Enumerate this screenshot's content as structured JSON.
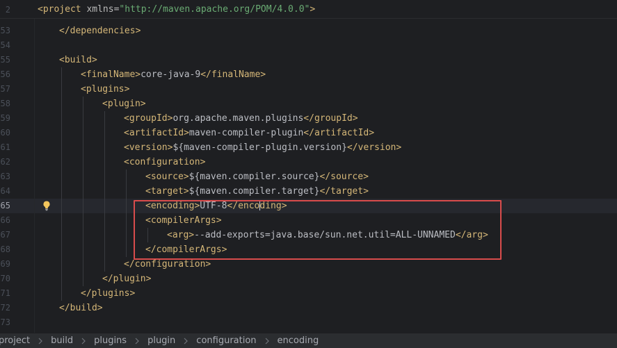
{
  "sticky": {
    "line_number": "2",
    "tag_open": "<project",
    "attr_name": "xmlns",
    "equals": "=",
    "attr_value": "\"http://maven.apache.org/POM/4.0.0\"",
    "tag_close": ">"
  },
  "editor": {
    "lines": [
      {
        "n": "53",
        "indent": 1,
        "parts": [
          {
            "c": "tg",
            "t": "</dependencies>"
          }
        ]
      },
      {
        "n": "54",
        "indent": 0,
        "parts": []
      },
      {
        "n": "55",
        "indent": 1,
        "parts": [
          {
            "c": "tg",
            "t": "<build>"
          }
        ]
      },
      {
        "n": "56",
        "indent": 2,
        "parts": [
          {
            "c": "tg",
            "t": "<finalName>"
          },
          {
            "c": "tx",
            "t": "core-java-9"
          },
          {
            "c": "tg",
            "t": "</finalName>"
          }
        ]
      },
      {
        "n": "57",
        "indent": 2,
        "parts": [
          {
            "c": "tg",
            "t": "<plugins>"
          }
        ]
      },
      {
        "n": "58",
        "indent": 3,
        "parts": [
          {
            "c": "tg",
            "t": "<plugin>"
          }
        ]
      },
      {
        "n": "59",
        "indent": 4,
        "parts": [
          {
            "c": "tg",
            "t": "<groupId>"
          },
          {
            "c": "tx",
            "t": "org.apache.maven.plugins"
          },
          {
            "c": "tg",
            "t": "</groupId>"
          }
        ]
      },
      {
        "n": "60",
        "indent": 4,
        "parts": [
          {
            "c": "tg",
            "t": "<artifactId>"
          },
          {
            "c": "tx",
            "t": "maven-compiler-plugin"
          },
          {
            "c": "tg",
            "t": "</artifactId>"
          }
        ]
      },
      {
        "n": "61",
        "indent": 4,
        "parts": [
          {
            "c": "tg",
            "t": "<version>"
          },
          {
            "c": "tx",
            "t": "${maven-compiler-plugin.version}"
          },
          {
            "c": "tg",
            "t": "</version>"
          }
        ]
      },
      {
        "n": "62",
        "indent": 4,
        "parts": [
          {
            "c": "tg",
            "t": "<configuration>"
          }
        ]
      },
      {
        "n": "63",
        "indent": 5,
        "parts": [
          {
            "c": "tg",
            "t": "<source>"
          },
          {
            "c": "tx",
            "t": "${maven.compiler.source}"
          },
          {
            "c": "tg",
            "t": "</source>"
          }
        ]
      },
      {
        "n": "64",
        "indent": 5,
        "parts": [
          {
            "c": "tg",
            "t": "<target>"
          },
          {
            "c": "tx",
            "t": "${maven.compiler.target}"
          },
          {
            "c": "tg",
            "t": "</target>"
          }
        ]
      },
      {
        "n": "65",
        "indent": 5,
        "current": true,
        "bulb": true,
        "parts": [
          {
            "c": "tg",
            "t": "<encoding>"
          },
          {
            "c": "tx",
            "t": "UTF-8"
          },
          {
            "c": "tg",
            "t": "</enco"
          },
          {
            "c": "caret",
            "t": ""
          },
          {
            "c": "tg",
            "t": "ding>"
          }
        ]
      },
      {
        "n": "66",
        "indent": 5,
        "parts": [
          {
            "c": "tg",
            "t": "<compilerArgs>"
          }
        ]
      },
      {
        "n": "67",
        "indent": 6,
        "parts": [
          {
            "c": "tg",
            "t": "<arg>"
          },
          {
            "c": "tx",
            "t": "--add-exports=java.base/sun.net.util=ALL-UNNAMED"
          },
          {
            "c": "tg",
            "t": "</arg>"
          }
        ]
      },
      {
        "n": "68",
        "indent": 5,
        "parts": [
          {
            "c": "tg",
            "t": "</compilerArgs>"
          }
        ]
      },
      {
        "n": "69",
        "indent": 4,
        "parts": [
          {
            "c": "tg",
            "t": "</configuration>"
          }
        ]
      },
      {
        "n": "70",
        "indent": 3,
        "parts": [
          {
            "c": "tg",
            "t": "</plugin>"
          }
        ]
      },
      {
        "n": "71",
        "indent": 2,
        "parts": [
          {
            "c": "tg",
            "t": "</plugins>"
          }
        ]
      },
      {
        "n": "72",
        "indent": 1,
        "parts": [
          {
            "c": "tg",
            "t": "</build>"
          }
        ]
      },
      {
        "n": "73",
        "indent": 0,
        "parts": []
      }
    ]
  },
  "breadcrumbs": [
    "project",
    "build",
    "plugins",
    "plugin",
    "configuration",
    "encoding"
  ],
  "icons": {
    "intention": "lightbulb-icon",
    "separator": "chevron-right-icon"
  },
  "colors": {
    "background": "#1e1f22",
    "tag": "#d5b778",
    "text": "#bcbec4",
    "attr_value": "#6aab73",
    "highlight_box": "#d94c4c",
    "bulb": "#f2c55c"
  }
}
